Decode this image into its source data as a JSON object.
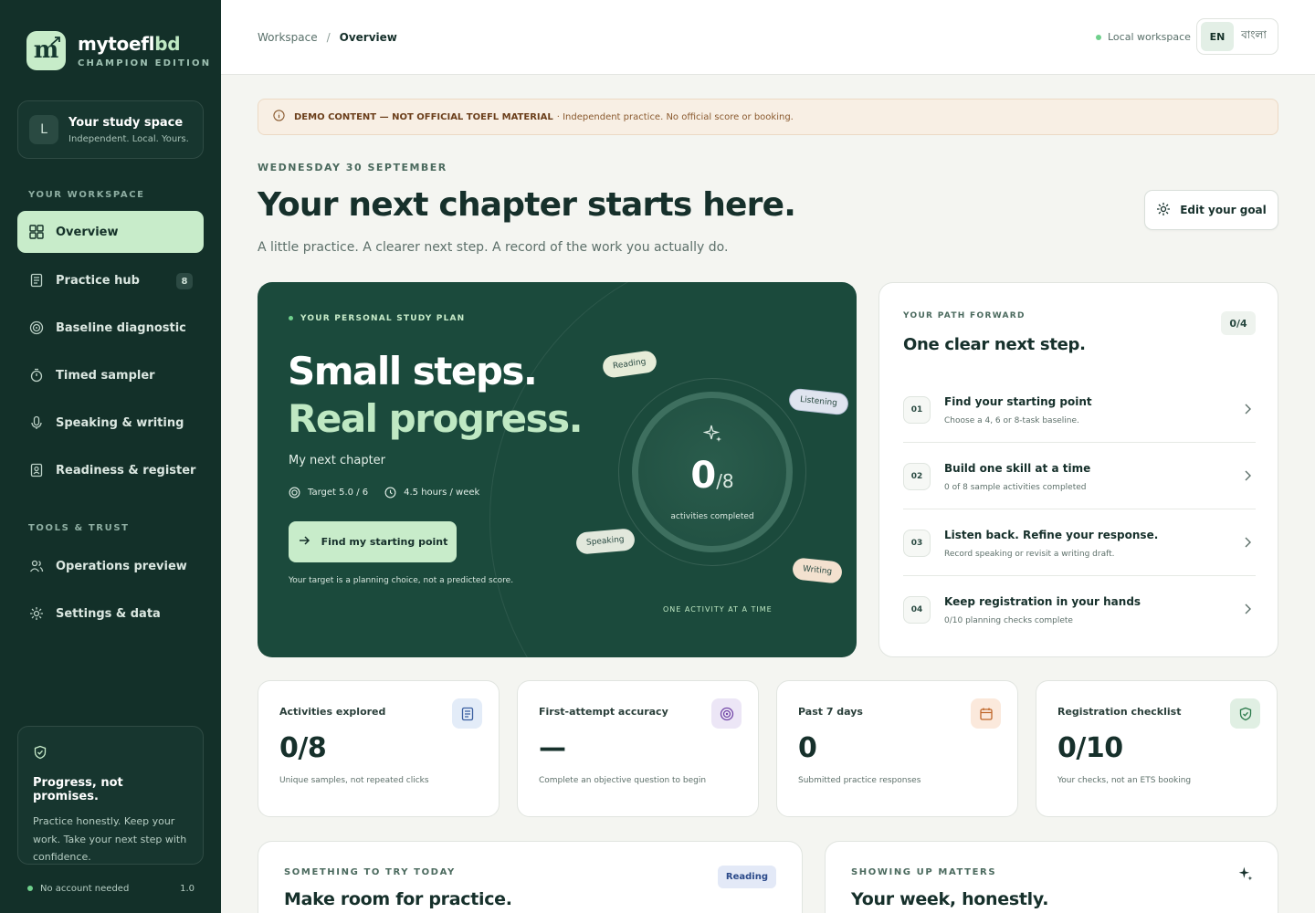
{
  "brand": {
    "name_a": "mytoefl",
    "name_b": "bd",
    "edition": "CHAMPION EDITION"
  },
  "study_space": {
    "initial": "L",
    "title": "Your study space",
    "subtitle": "Independent. Local. Yours."
  },
  "sidebar": {
    "workspace_heading": "YOUR WORKSPACE",
    "workspace_items": [
      {
        "label": "Overview",
        "icon": "grid-icon",
        "active": true
      },
      {
        "label": "Practice hub",
        "icon": "document-icon",
        "badge": "8"
      },
      {
        "label": "Baseline diagnostic",
        "icon": "target-icon"
      },
      {
        "label": "Timed sampler",
        "icon": "stopwatch-icon"
      },
      {
        "label": "Speaking & writing",
        "icon": "microphone-icon"
      },
      {
        "label": "Readiness & register",
        "icon": "id-card-icon"
      }
    ],
    "tools_heading": "TOOLS & TRUST",
    "tools_items": [
      {
        "label": "Operations preview",
        "icon": "users-icon"
      },
      {
        "label": "Settings & data",
        "icon": "gear-icon"
      }
    ],
    "promise": {
      "title": "Progress, not promises.",
      "body": "Practice honestly. Keep your work. Take your next step with confidence."
    },
    "footer": {
      "status": "No account needed",
      "version": "1.0"
    }
  },
  "topbar": {
    "breadcrumb": [
      "Workspace",
      "Overview"
    ],
    "workspace_status": "Local workspace",
    "lang_en": "EN",
    "lang_bn": "বাংলা"
  },
  "banner": {
    "label": "DEMO CONTENT — NOT OFFICIAL TOEFL MATERIAL",
    "text": "· Independent practice. No official score or booking."
  },
  "hero": {
    "date": "WEDNESDAY 30 SEPTEMBER",
    "title": "Your next chapter starts here.",
    "subtitle": "A little practice. A clearer next step. A record of the work you actually do.",
    "goal_button": "Edit your goal"
  },
  "plan": {
    "eyebrow": "YOUR PERSONAL STUDY PLAN",
    "headline_1": "Small steps.",
    "headline_2": "Real progress.",
    "next_chapter": "My next chapter",
    "target": "Target 5.0 / 6",
    "hours": "4.5 hours / week",
    "cta": "Find my starting point",
    "note": "Your target is a planning choice, not a predicted score.",
    "progress": {
      "done": "0",
      "total": "/8",
      "label": "activities completed",
      "fraction": 0
    },
    "chips": {
      "reading": "Reading",
      "listening": "Listening",
      "speaking": "Speaking",
      "writing": "Writing"
    },
    "footer": "ONE ACTIVITY AT A TIME"
  },
  "path": {
    "eyebrow": "YOUR PATH FORWARD",
    "title": "One clear next step.",
    "count": "0/4",
    "steps": [
      {
        "num": "01",
        "title": "Find your starting point",
        "desc": "Choose a 4, 6 or 8-task baseline."
      },
      {
        "num": "02",
        "title": "Build one skill at a time",
        "desc": "0 of 8 sample activities completed"
      },
      {
        "num": "03",
        "title": "Listen back. Refine your response.",
        "desc": "Record speaking or revisit a writing draft."
      },
      {
        "num": "04",
        "title": "Keep registration in your hands",
        "desc": "0/10 planning checks complete"
      }
    ]
  },
  "stats": [
    {
      "label": "Activities explored",
      "value": "0/8",
      "desc": "Unique samples, not repeated clicks",
      "icon": "document-icon",
      "color": "#e3ecf8"
    },
    {
      "label": "First-attempt accuracy",
      "value": "—",
      "desc": "Complete an objective question to begin",
      "icon": "target-icon",
      "color": "#ece6f6"
    },
    {
      "label": "Past 7 days",
      "value": "0",
      "desc": "Submitted practice responses",
      "icon": "calendar-icon",
      "color": "#fbe9dc"
    },
    {
      "label": "Registration checklist",
      "value": "0/10",
      "desc": "Your checks, not an ETS booking",
      "icon": "shield-check-icon",
      "color": "#e0efe3"
    }
  ],
  "bottom": {
    "today": {
      "eyebrow": "SOMETHING TO TRY TODAY",
      "title": "Make room for practice.",
      "badge": "Reading"
    },
    "week": {
      "eyebrow": "SHOWING UP MATTERS",
      "title": "Your week, honestly."
    }
  }
}
